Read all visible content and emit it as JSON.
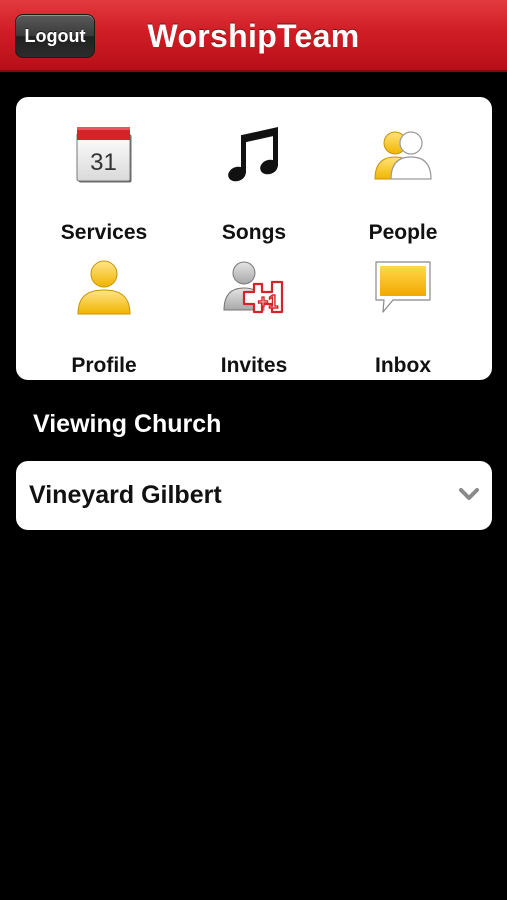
{
  "header": {
    "title": "WorshipTeam",
    "logout_label": "Logout",
    "bar_color": "#d01d25"
  },
  "menu": {
    "items": [
      {
        "label": "Services",
        "icon": "calendar-icon",
        "calendar_day": "31"
      },
      {
        "label": "Songs",
        "icon": "music-note-icon"
      },
      {
        "label": "People",
        "icon": "people-icon"
      },
      {
        "label": "Profile",
        "icon": "person-icon"
      },
      {
        "label": "Invites",
        "icon": "invite-plus-one-icon",
        "badge_text": "+1"
      },
      {
        "label": "Inbox",
        "icon": "speech-bubble-icon"
      }
    ]
  },
  "church": {
    "section_label": "Viewing Church",
    "selected": "Vineyard Gilbert",
    "dropdown_icon": "chevron-down-icon"
  },
  "colors": {
    "background": "#000000",
    "accent_red": "#d01d25",
    "icon_yellow": "#f5c518"
  }
}
